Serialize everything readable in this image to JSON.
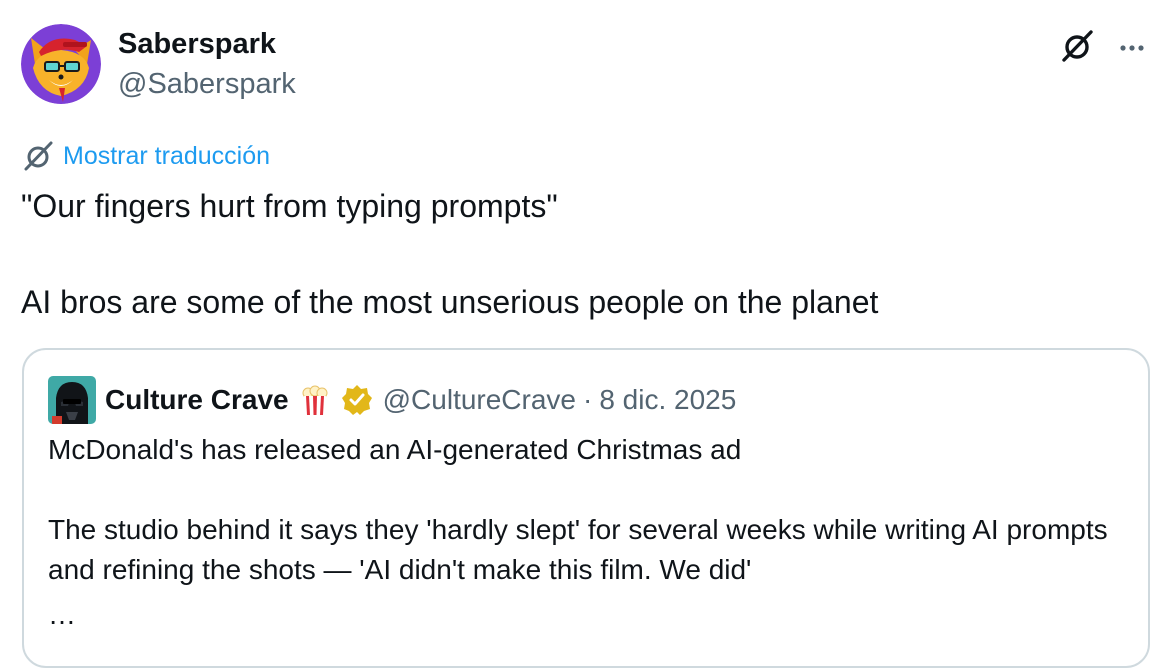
{
  "tweet": {
    "author": {
      "display_name": "Saberspark",
      "handle": "@Saberspark",
      "avatar": "fox-with-sunglasses-avatar"
    },
    "translate_link": "Mostrar traducción",
    "text": "\"Our fingers hurt from typing prompts\"\n\nAI bros are some of the most unserious people on the planet",
    "header_actions": [
      {
        "name": "grok-icon"
      },
      {
        "name": "more-options-icon"
      }
    ]
  },
  "quoted": {
    "author": {
      "display_name": "Culture Crave",
      "emoji": "popcorn-icon",
      "badge": "verified-gold-badge",
      "handle": "@CultureCrave",
      "avatar": "darth-vader-avatar"
    },
    "separator": "·",
    "date": "8 dic. 2025",
    "text": "McDonald's has released an AI-generated Christmas ad\n\nThe studio behind it says they 'hardly slept' for several weeks while writing AI prompts and refining the shots — 'AI didn't make this film. We did'",
    "ellipsis": "…"
  },
  "colors": {
    "text_primary": "#0f1419",
    "text_secondary": "#536471",
    "link": "#1d9bf0",
    "border": "#cfd9de",
    "verified_gold": "#e2b719",
    "avatar_bg": "#7c3fd6"
  }
}
